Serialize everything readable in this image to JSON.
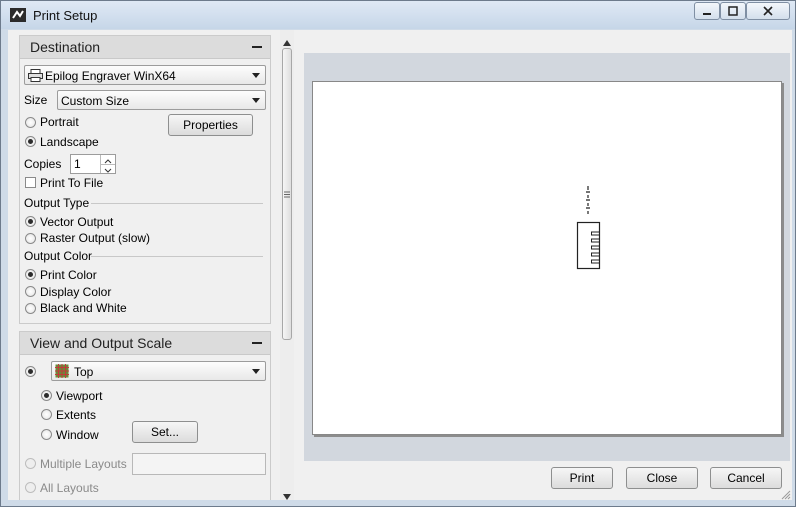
{
  "window": {
    "title": "Print Setup"
  },
  "destination": {
    "title": "Destination",
    "printer": "Epilog Engraver WinX64",
    "size_label": "Size",
    "size_value": "Custom Size",
    "orientation": {
      "portrait": "Portrait",
      "landscape": "Landscape",
      "selected": "Landscape"
    },
    "properties_button": "Properties",
    "copies_label": "Copies",
    "copies_value": "1",
    "print_to_file": "Print To File"
  },
  "output_type": {
    "label": "Output Type",
    "vector": "Vector Output",
    "raster": "Raster Output (slow)",
    "selected": "Vector Output"
  },
  "output_color": {
    "label": "Output Color",
    "print": "Print Color",
    "display": "Display Color",
    "bw": "Black and White",
    "selected": "Print Color"
  },
  "view_scale": {
    "title": "View and Output Scale",
    "view_value": "Top",
    "viewport": "Viewport",
    "extents": "Extents",
    "window": "Window",
    "set_button": "Set...",
    "multiple_layouts": "Multiple Layouts",
    "all_layouts": "All Layouts",
    "selected_area": "Viewport"
  },
  "footer": {
    "print": "Print",
    "close": "Close",
    "cancel": "Cancel"
  }
}
